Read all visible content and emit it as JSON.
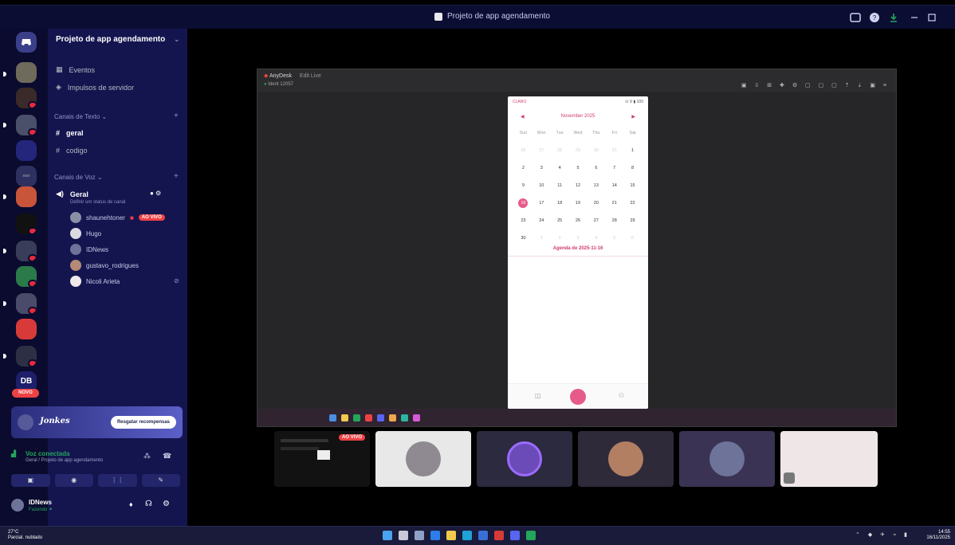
{
  "window": {
    "title": "Projeto de app agendamento"
  },
  "server": {
    "name": "Projeto de app agendamento",
    "items": [
      {
        "label": "Eventos",
        "icon": "calendar-icon"
      },
      {
        "label": "Impulsos de servidor",
        "icon": "boost-icon"
      }
    ],
    "text_category": "Canais de Texto",
    "text_channels": [
      {
        "name": "geral",
        "active": true
      },
      {
        "name": "codigo",
        "active": false
      }
    ],
    "voice_category": "Canais de Voz",
    "voice_channel": {
      "name": "Geral",
      "status": "Definir um status de canal"
    },
    "voice_users": [
      {
        "name": "shaunehtoner",
        "live": true,
        "color": "#8a8fa6"
      },
      {
        "name": "Hugo",
        "live": false,
        "color": "#d9d9e0"
      },
      {
        "name": "IDNews",
        "live": false,
        "color": "#6d7399"
      },
      {
        "name": "gustavo_rodrigues",
        "live": false,
        "color": "#b58a77"
      },
      {
        "name": "Nicoli Arieta",
        "live": false,
        "color": "#f0e8ea"
      }
    ],
    "live_label": "AO VIVO"
  },
  "rail": {
    "new_badge": "NOVO",
    "short_label": "DB"
  },
  "promo": {
    "brand": "Jonkes",
    "button": "Resgatar recompensas"
  },
  "voice_panel": {
    "status": "Voz conectada",
    "subtitle": "Geral / Projeto de app agendamento",
    "buttons": [
      "▣",
      "◉",
      "⋮⋮",
      "✎"
    ]
  },
  "user_panel": {
    "name": "IDNews",
    "status": "Fazendo ✦"
  },
  "mirror": {
    "app_name": "AnyDesk",
    "tab": "Edit Live",
    "session": "Ident 12057"
  },
  "phone": {
    "carrier": "CLARO",
    "status_right": "⊙ ᐯ ▮ 100",
    "month": "November 2025",
    "weekdays": [
      "Sun",
      "Mon",
      "Tue",
      "Wed",
      "Thu",
      "Fri",
      "Sat"
    ],
    "days": [
      {
        "d": "26",
        "m": true
      },
      {
        "d": "27",
        "m": true
      },
      {
        "d": "28",
        "m": true
      },
      {
        "d": "29",
        "m": true
      },
      {
        "d": "30",
        "m": true
      },
      {
        "d": "31",
        "m": true
      },
      {
        "d": "1",
        "m": false
      },
      {
        "d": "2",
        "m": false
      },
      {
        "d": "3",
        "m": false
      },
      {
        "d": "4",
        "m": false
      },
      {
        "d": "5",
        "m": false
      },
      {
        "d": "6",
        "m": false
      },
      {
        "d": "7",
        "m": false
      },
      {
        "d": "8",
        "m": false
      },
      {
        "d": "9",
        "m": false
      },
      {
        "d": "10",
        "m": false
      },
      {
        "d": "11",
        "m": false
      },
      {
        "d": "12",
        "m": false
      },
      {
        "d": "13",
        "m": false
      },
      {
        "d": "14",
        "m": false
      },
      {
        "d": "15",
        "m": false
      },
      {
        "d": "16",
        "m": false,
        "sel": true
      },
      {
        "d": "17",
        "m": false
      },
      {
        "d": "18",
        "m": false
      },
      {
        "d": "19",
        "m": false
      },
      {
        "d": "20",
        "m": false
      },
      {
        "d": "21",
        "m": false
      },
      {
        "d": "22",
        "m": false
      },
      {
        "d": "23",
        "m": false
      },
      {
        "d": "24",
        "m": false
      },
      {
        "d": "25",
        "m": false
      },
      {
        "d": "26",
        "m": false
      },
      {
        "d": "27",
        "m": false
      },
      {
        "d": "28",
        "m": false
      },
      {
        "d": "29",
        "m": false
      },
      {
        "d": "30",
        "m": false
      },
      {
        "d": "1",
        "m": true
      },
      {
        "d": "2",
        "m": true
      },
      {
        "d": "3",
        "m": true
      },
      {
        "d": "4",
        "m": true
      },
      {
        "d": "5",
        "m": true
      },
      {
        "d": "6",
        "m": true
      }
    ],
    "agenda": "Agenda de 2025-11-16"
  },
  "tiles": [
    {
      "kind": "screen",
      "live": true,
      "bg": "#121212",
      "avatar": ""
    },
    {
      "kind": "avatar",
      "live": false,
      "bg": "#e8e8e8",
      "avatar": "#8f8a92"
    },
    {
      "kind": "avatar",
      "live": false,
      "bg": "#2b2a3e",
      "avatar": "#6b4bb8"
    },
    {
      "kind": "avatar",
      "live": false,
      "bg": "#2e2a3a",
      "avatar": "#b27f62"
    },
    {
      "kind": "avatar",
      "live": false,
      "bg": "#3a3353",
      "avatar": "#6d7399"
    },
    {
      "kind": "avatar",
      "live": false,
      "bg": "#efe6e8",
      "avatar": "#efe6e8"
    }
  ],
  "taskbar": {
    "temp": "27°C",
    "weather": "Parcial. nublado",
    "time": "14:55",
    "date": "16/11/2025"
  },
  "colors": {
    "sidebar": "#14154f",
    "rail": "#0a0b2e",
    "accent_pink": "#e75b8a",
    "live_red": "#ed4245",
    "connected_green": "#23a55a"
  }
}
